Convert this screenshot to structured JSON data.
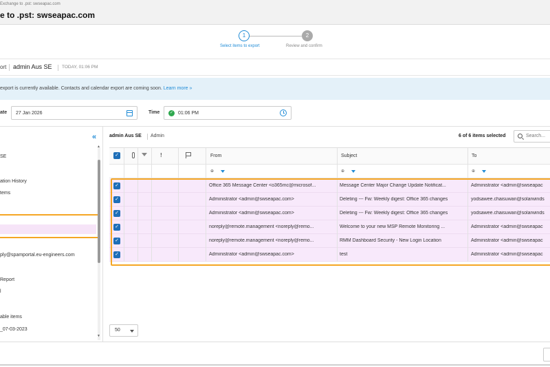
{
  "window": {
    "breadcrumb": "Exchange to .pst: swseapac.com",
    "title": "e to .pst: swseapac.com"
  },
  "stepper": {
    "steps": [
      {
        "number": "1",
        "label": "Select items to export"
      },
      {
        "number": "2",
        "label": "Review and confirm"
      }
    ]
  },
  "export": {
    "label": "ort",
    "user": "admin Aus SE",
    "time": "TODAY, 01:06 PM"
  },
  "info": {
    "text": "export is currently available. Contacts and calendar export are coming soon.",
    "link": "Learn more »"
  },
  "datetime": {
    "date_label": "ate",
    "date_value": "27 Jan 2026",
    "time_label": "Time",
    "time_value": "01:06 PM"
  },
  "sidebar": {
    "items": [
      "SE",
      "ation History",
      "tems",
      "",
      "",
      "ply@spamportal.eu-engineers.com",
      "Report",
      "l",
      "able items",
      "_07-03-2023"
    ]
  },
  "content": {
    "title": "admin Aus SE",
    "subtitle": "Admin",
    "selection_count": "6 of 6 items selected",
    "search_placeholder": "Search..."
  },
  "grid": {
    "columns": {
      "from": "From",
      "subject": "Subject",
      "to": "To"
    },
    "rows": [
      {
        "from": "Office 365 Message Center <o365mc@microsof...",
        "subject": "Message Center Major Change Update Notificat...",
        "to": "Administrator <admin@swseapac"
      },
      {
        "from": "Administrator <admin@swseapac.com>",
        "subject": "Deleting --- Fw: Weekly digest: Office 365 changes",
        "to": "yodsawee.chaisuwan@solarwinds"
      },
      {
        "from": "Administrator <admin@swseapac.com>",
        "subject": "Deleting --- Fw: Weekly digest: Office 365 changes",
        "to": "yodsawee.chaisuwan@solarwinds"
      },
      {
        "from": "noreply@remote.management <noreply@remo...",
        "subject": "Welcome to your new MSP Remote Monitoring ...",
        "to": "Administrator <admin@swseapac"
      },
      {
        "from": "noreply@remote.management <noreply@remo...",
        "subject": "RMM Dashboard Security - New Login Location",
        "to": "Administrator <admin@swseapac"
      },
      {
        "from": "Administrator <admin@swseapac.com>",
        "subject": "test",
        "to": "Administrator <admin@swseapac"
      }
    ]
  },
  "pager": {
    "page_size": "50"
  },
  "colors": {
    "accent": "#1f8bd6",
    "highlight": "#f5a623",
    "row_selected": "#f8e9fb",
    "info_bg": "#e4f1f9"
  }
}
